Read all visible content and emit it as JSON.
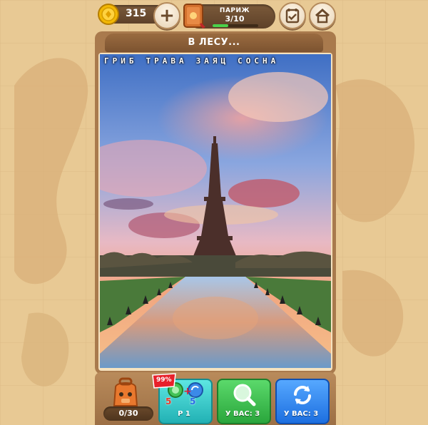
{
  "header": {
    "coins": "315",
    "city": "ПАРИЖ",
    "level": "3/10",
    "progress": 0.35
  },
  "puzzle": {
    "title": "В ЛЕСУ...",
    "words": [
      "ГРИБ",
      "ТРАВА",
      "ЗАЯЦ",
      "СОСНА"
    ]
  },
  "bottom": {
    "bag_count": "0/30",
    "sale_badge": "99%",
    "hint1_label": "Р 1",
    "hint1_left_value": "5",
    "hint1_right_value": "5",
    "magnifier_label": "У ВАС: 3",
    "shuffle_label": "У ВАС: 3"
  },
  "colors": {
    "background": "#e8c994",
    "board": "#a97a4d",
    "green_button": "#2aa63c",
    "blue_button": "#1d6fe0",
    "teal_button": "#22b1b4"
  },
  "icons": [
    "coin-icon",
    "plus-icon",
    "book-icon",
    "checklist-icon",
    "home-icon",
    "backpack-icon",
    "magnifier-icon",
    "refresh-icon"
  ]
}
